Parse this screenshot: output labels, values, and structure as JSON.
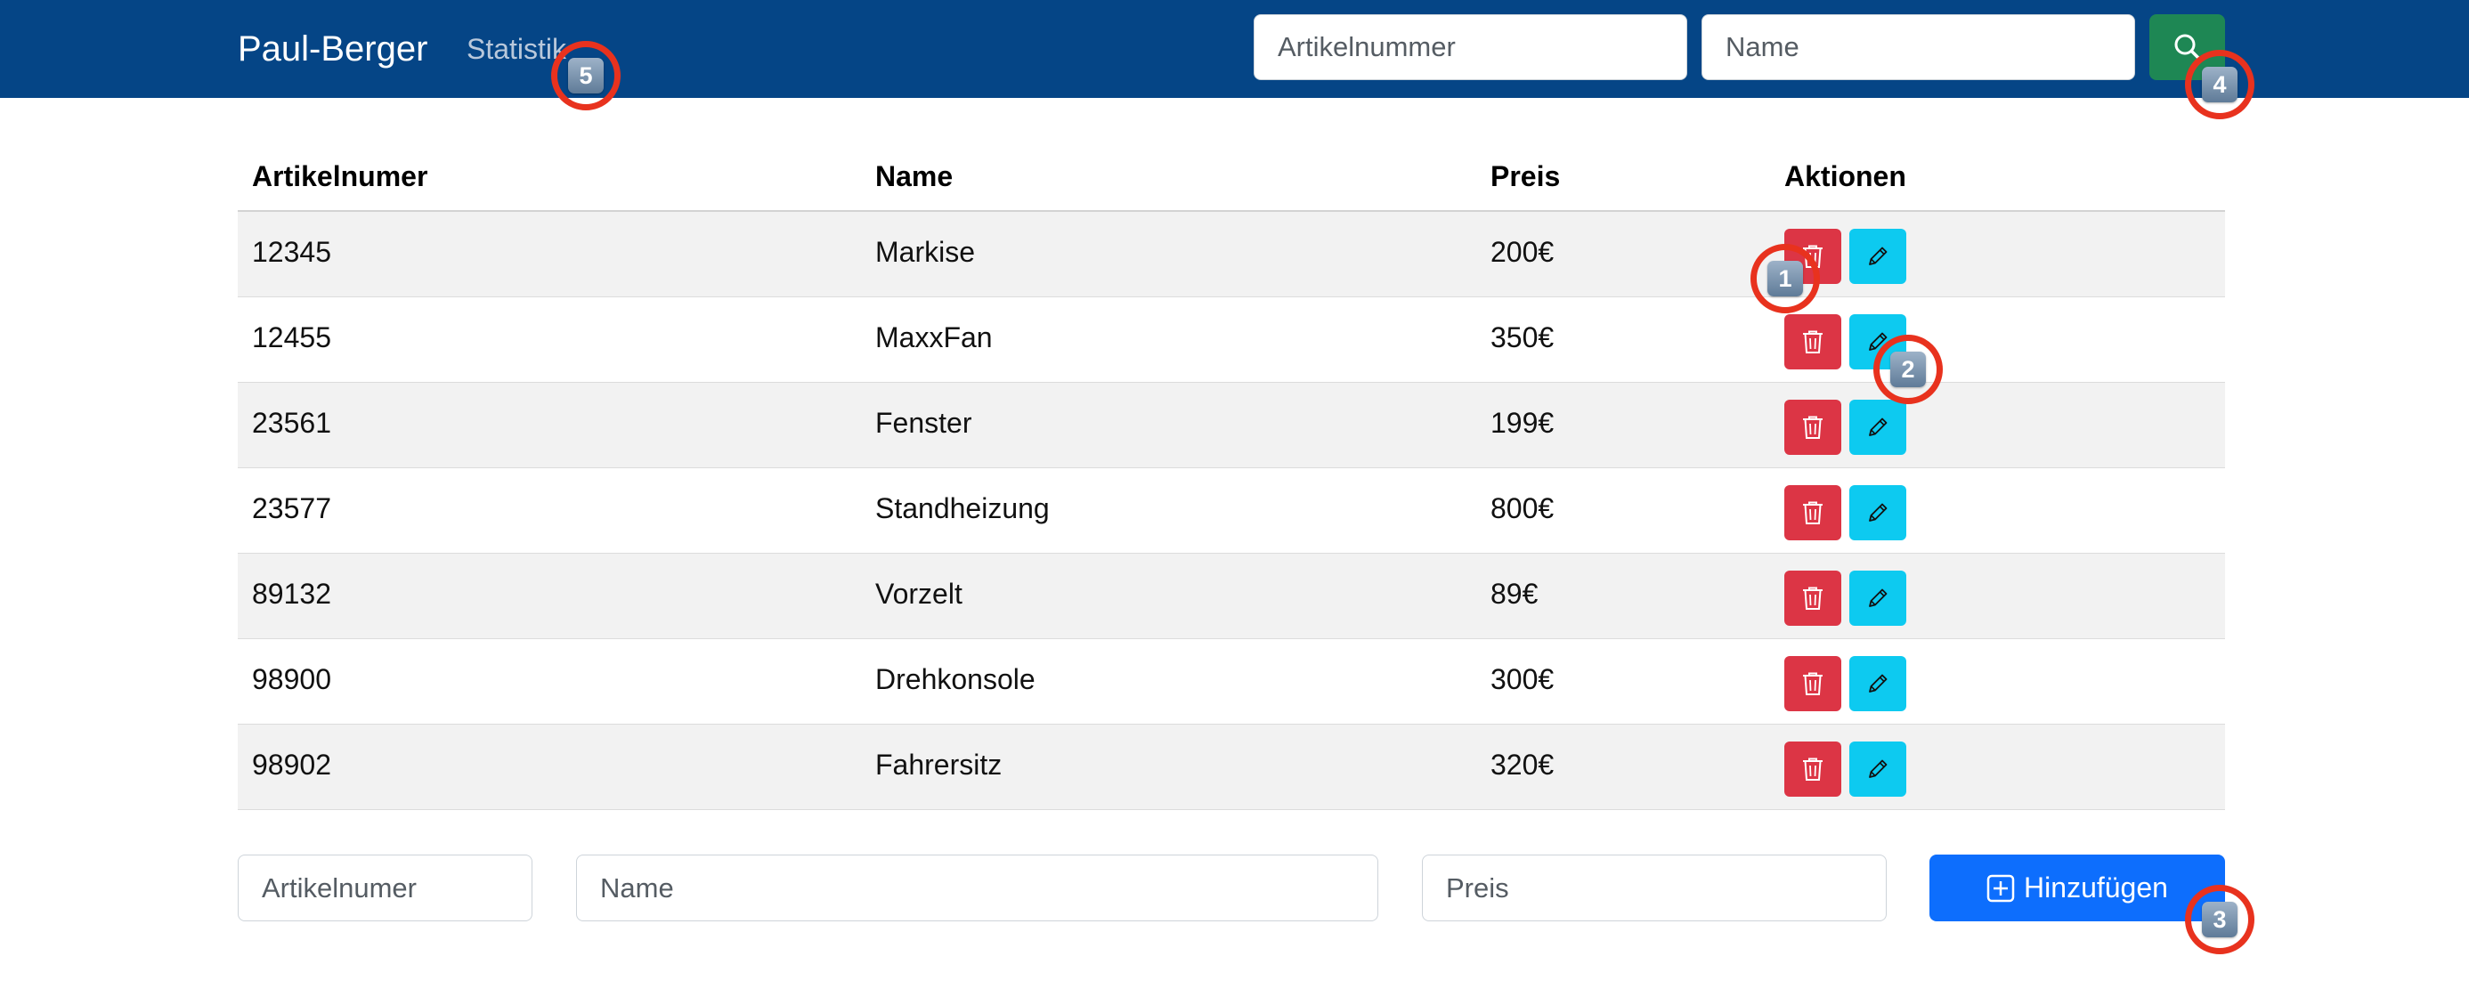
{
  "navbar": {
    "brand": "Paul-Berger",
    "link_statistik": "Statistik",
    "search_artnr_placeholder": "Artikelnummer",
    "search_name_placeholder": "Name"
  },
  "table": {
    "headers": [
      "Artikelnumer",
      "Name",
      "Preis",
      "Aktionen"
    ],
    "rows": [
      {
        "artnr": "12345",
        "name": "Markise",
        "price": "200€"
      },
      {
        "artnr": "12455",
        "name": "MaxxFan",
        "price": "350€"
      },
      {
        "artnr": "23561",
        "name": "Fenster",
        "price": "199€"
      },
      {
        "artnr": "23577",
        "name": "Standheizung",
        "price": "800€"
      },
      {
        "artnr": "89132",
        "name": "Vorzelt",
        "price": "89€"
      },
      {
        "artnr": "98900",
        "name": "Drehkonsole",
        "price": "300€"
      },
      {
        "artnr": "98902",
        "name": "Fahrersitz",
        "price": "320€"
      }
    ]
  },
  "add_form": {
    "artnr_placeholder": "Artikelnumer",
    "name_placeholder": "Name",
    "price_placeholder": "Preis",
    "add_label": "Hinzufügen"
  },
  "markers": [
    "1",
    "2",
    "3",
    "4",
    "5"
  ],
  "colors": {
    "navbar": "#054586",
    "search_button": "#1e8754",
    "delete_button": "#dc3545",
    "edit_button": "#0dcaf0",
    "add_button": "#0d6efd",
    "marker_ring": "#e8321e"
  },
  "icons": {
    "search": "search-icon",
    "delete": "trash-icon",
    "edit": "pencil-icon",
    "add": "plus-square-icon"
  }
}
